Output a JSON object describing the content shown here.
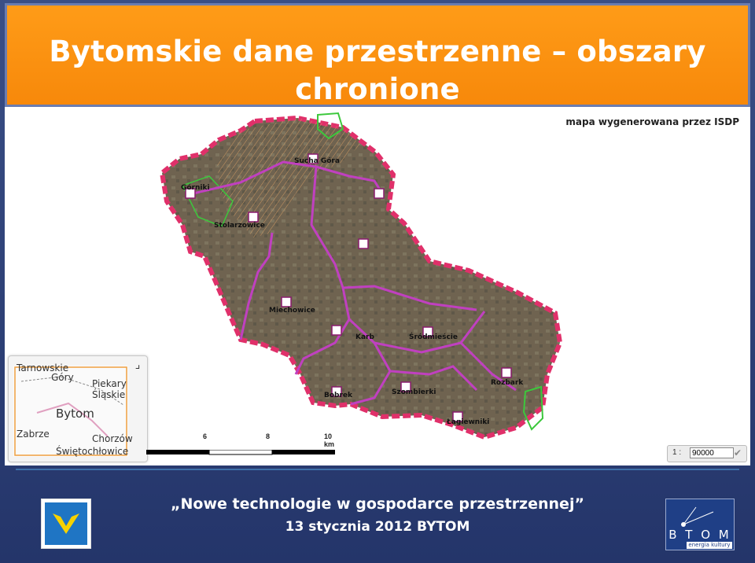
{
  "title": {
    "line1": "Bytomskie dane przestrzenne – obszary",
    "line2": "chronione"
  },
  "map": {
    "caption": "mapa wygenerowana przez ISDP",
    "districts": {
      "sucha_gora": "Sucha Góra",
      "gorniki": "Górniki",
      "stolarzowice": "Stolarzowice",
      "miechowice": "Miechowice",
      "karb": "Karb",
      "srodmiescie": "Śródmieście",
      "rozbark": "Rozbark",
      "bobrek": "Bobrek",
      "szombierki": "Szombierki",
      "lagiewniki": "Łagiewniki"
    },
    "overview_map": {
      "tarnowskie": "Tarnowskie",
      "gory": "Góry",
      "piekary": "Piekary",
      "slaskie": "Śląskie",
      "bytom": "Bytom",
      "zabrze": "Zabrze",
      "chorzow": "Chorzów",
      "swietochlowice": "Świętochłowice"
    },
    "scale_ticks": [
      "6",
      "8",
      "10 km"
    ],
    "scale_prefix": "1 :",
    "scale_value": "90000"
  },
  "footer": {
    "line1": "„Nowe technologie w gospodarce przestrzennej”",
    "line2": "13 stycznia 2012 BYTOM"
  },
  "logo_right": {
    "brand": "B  T O M",
    "tagline": "energia kultury"
  },
  "colors": {
    "title_bg": "#f7880a",
    "footer_bg": "#2c3e6e",
    "boundary": "#e0306a",
    "roads": "#c040c0",
    "protected": "#3cc83c"
  }
}
